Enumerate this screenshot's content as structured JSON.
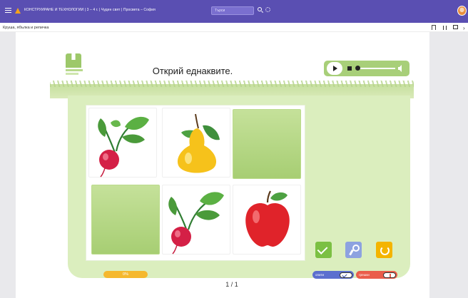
{
  "topbar": {
    "title": "КОНСТРУИРАНЕ И ТЕХНОЛОГИИ | 3 – 4 г. | Чуден свят | Просвета – София",
    "search_placeholder": "Търси"
  },
  "subbar": {
    "breadcrumb": "Круша, ябълка и репичка"
  },
  "activity": {
    "title": "Открий еднаквите.",
    "progress_label": "0%",
    "progress_value": 0,
    "pager": "1 / 1",
    "toggle_correct": "опити",
    "toggle_wrong": "грешки"
  },
  "tiles": [
    {
      "content": "radish-icon",
      "face_up": true
    },
    {
      "content": "pear-icon",
      "face_up": true
    },
    {
      "content": "card-back",
      "face_up": false
    },
    {
      "content": "card-back",
      "face_up": false
    },
    {
      "content": "radish-icon",
      "face_up": true
    },
    {
      "content": "apple-icon",
      "face_up": true
    }
  ],
  "colors": {
    "topbar": "#5a4fb2",
    "accent_green": "#a8cf79",
    "check": "#7bc043",
    "key": "#8da2e0",
    "redo": "#f4b400",
    "progress": "#f5b82e"
  }
}
